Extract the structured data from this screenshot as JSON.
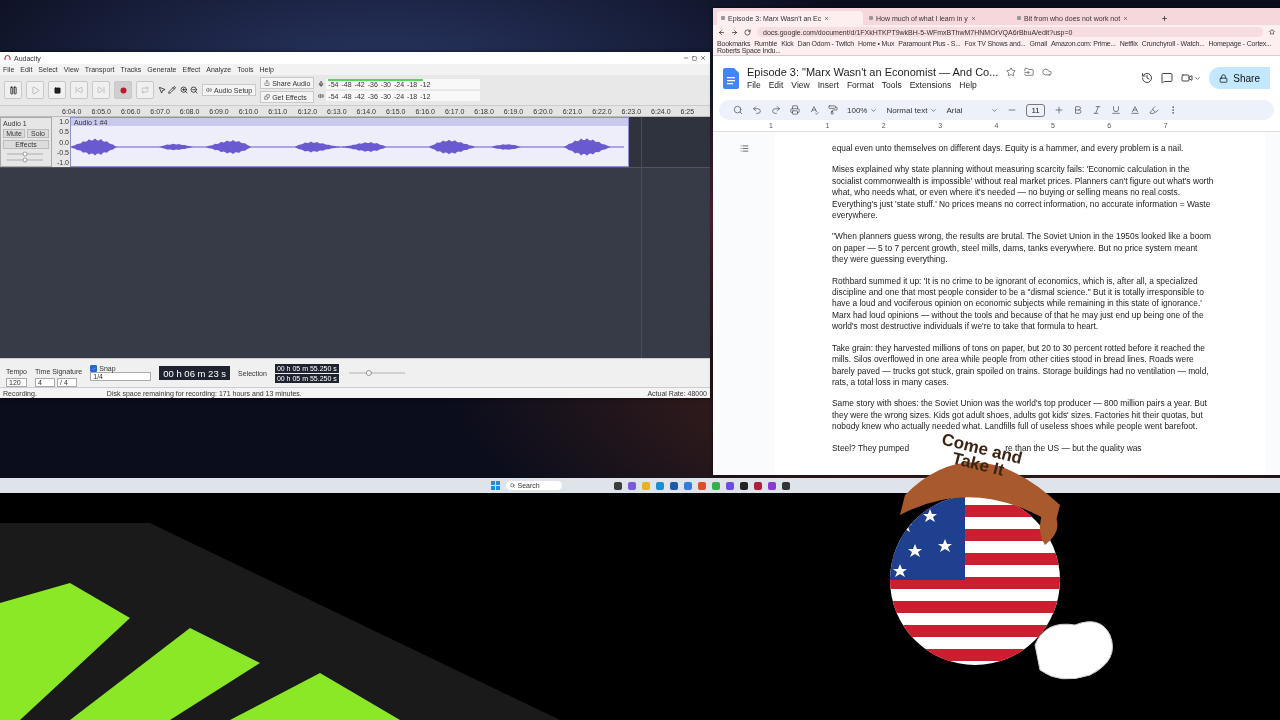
{
  "audacity": {
    "title": "Audacity",
    "menu": [
      "File",
      "Edit",
      "Select",
      "View",
      "Transport",
      "Tracks",
      "Generate",
      "Effect",
      "Analyze",
      "Tools",
      "Help"
    ],
    "audio_setup": "Audio Setup",
    "share_audio": "Share Audio",
    "get_effects": "Get Effects",
    "recording_meter_scale": [
      "-54",
      "-48",
      "-42",
      "-36",
      "-30",
      "-24",
      "-18",
      "-12"
    ],
    "playback_meter_scale": [
      "-54",
      "-48",
      "-42",
      "-36",
      "-30",
      "-24",
      "-18",
      "-12"
    ],
    "gain": {
      "level": 0.5
    },
    "pan": {
      "level": 0.5
    },
    "playback_speed": {
      "level": 0.35
    },
    "ruler": [
      "6:04.0",
      "6:05.0",
      "6:06.0",
      "6:07.0",
      "6:08.0",
      "6:09.0",
      "6:10.0",
      "6:11.0",
      "6:12.0",
      "6:13.0",
      "6:14.0",
      "6:15.0",
      "6:16.0",
      "6:17.0",
      "6:18.0",
      "6:19.0",
      "6:20.0",
      "6:21.0",
      "6:22.0",
      "6:23.0",
      "6:24.0",
      "6:25"
    ],
    "track": {
      "name": "Audio 1",
      "mute": "Mute",
      "solo": "Solo",
      "effects": "Effects",
      "clip": "Audio 1 #4",
      "scale": [
        "1.0",
        "0.5",
        "0.0",
        "-0.5",
        "-1.0"
      ]
    },
    "tempo_label": "Tempo",
    "tempo": "120",
    "time_signature_label": "Time Signature",
    "time_signature": [
      "4",
      "/ 4"
    ],
    "snap": {
      "label": "Snap",
      "checked": true,
      "value": "1/4"
    },
    "time": "00 h 06 m 23 s",
    "selection_label": "Selection",
    "selection": [
      "00 h 05 m 55.250 s",
      "00 h 05 m 55.250 s"
    ],
    "status": "Recording.",
    "disk_space": "Disk space remaining for recording: 171 hours and 13 minutes.",
    "actual_rate": "Actual Rate: 48000"
  },
  "browser": {
    "tabs": [
      {
        "title": "Episode 3: Marx Wasn't an Ec",
        "selected": true
      },
      {
        "title": "How much of what I learn in y",
        "selected": false
      },
      {
        "title": "Bit from who does not work not",
        "selected": false
      }
    ],
    "url": "docs.google.com/document/d/1FXkHTKPT9wkBH-5-WFmxBThwM7HNMOrVQA6rBbuA/edit?usp=0",
    "bookmarks": [
      "Bookmarks",
      "Rumble",
      "Kick",
      "Dan Odom - Twitch",
      "Home • Mux",
      "Paramount Plus - S...",
      "Fox TV Shows and...",
      "Gmail",
      "Amazon.com: Prime...",
      "Netflix",
      "Crunchyroll - Watch...",
      "Homepage - Cortex...",
      "Roberts Space Indu..."
    ]
  },
  "doc": {
    "title": "Episode 3: \"Marx Wasn't an Economist — And Co...",
    "menu": [
      "File",
      "Edit",
      "View",
      "Insert",
      "Format",
      "Tools",
      "Extensions",
      "Help"
    ],
    "share": "Share",
    "zoom": "100%",
    "style": "Normal text",
    "font": "Arial",
    "font_size": "11",
    "ruler": [
      "1",
      "1",
      "2",
      "3",
      "4",
      "5",
      "6",
      "7"
    ],
    "paragraphs": [
      "equal even unto themselves on different days. Equity is a hammer, and every problem is a nail.",
      "Mises explained why state planning without measuring scarcity fails: 'Economic calculation in the socialist commonwealth is impossible' without real market prices. Planners can't figure out what's worth what, who needs what, or even where it's needed — no buying or selling means no real costs. Everything's just 'state stuff.' No prices means no correct information, no accurate information  = Waste everywhere.",
      "\"When planners guess wrong, the results are brutal.  The Soviet Union in the 1950s looked like a boom on paper — 5 to 7 percent growth, steel mills, dams, tanks everywhere. But no price system meant they were guessing everything.",
      "Rothbard summed it up: 'It is no crime to be ignorant of economics, which is, after all, a specialized discipline and one that most people consider to be a \"dismal science.\" But it is totally irresponsible to have a loud and vociferous opinion on economic subjects while remaining in this state of ignorance.' Marx had loud opinions — without the tools and because of that he may just end up being one of the world's most destructive individuals if we're to take that formula to heart.",
      "Take grain: they harvested millions of tons on paper, but 20 to 30 percent rotted before it reached the mills. Silos overflowed in one area while people from other cities stood in bread lines. Roads were barely paved — trucks got stuck, grain spoiled on trains. Storage buildings had no ventilation — mold, rats, a total loss in many cases.",
      "Same story with shoes: the Soviet Union was the world's top producer — 800 million pairs a year. But they were the wrong sizes. Kids got adult shoes, adults got kids' sizes. Factories hit their quotas, but nobody knew who actually needed what. Landfills full of useless shoes while people went barefoot."
    ],
    "last_line": [
      "Steel? They pumped",
      "re than the US — but the quality was"
    ]
  },
  "taskbar": {
    "search": "Search"
  },
  "overlay": {
    "hat_text": "Come and Take It"
  }
}
